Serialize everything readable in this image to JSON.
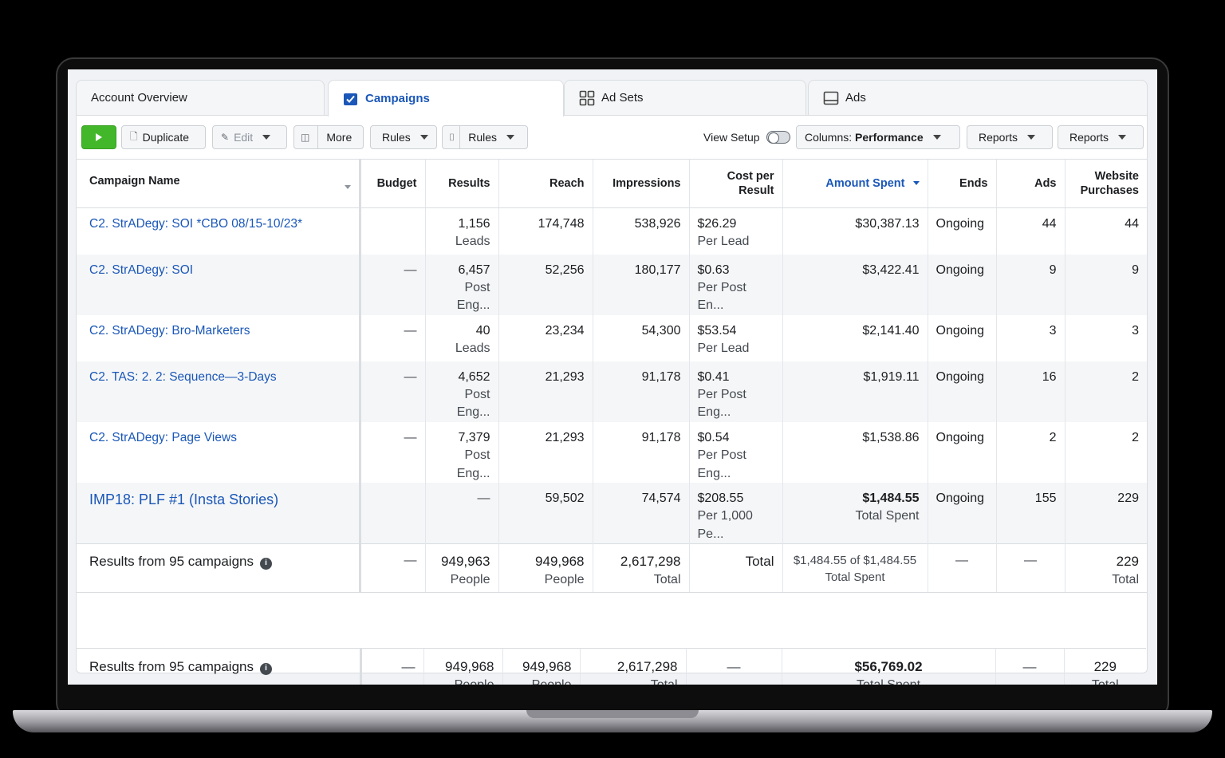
{
  "tabs": [
    {
      "label": "Account Overview",
      "icon": "none",
      "active": false
    },
    {
      "label": "Campaigns",
      "icon": "checkbox-icon",
      "active": true
    },
    {
      "label": "Ad Sets",
      "icon": "grid-icon",
      "active": false
    },
    {
      "label": "Ads",
      "icon": "ad-icon",
      "active": false
    }
  ],
  "toolbar": {
    "duplicate": "Duplicate",
    "edit": "Edit",
    "more": "More",
    "rules1": "Rules",
    "rules2": "Rules",
    "view_setup": "View Setup",
    "columns_prefix": "Columns: ",
    "columns_value": "Performance",
    "reports1": "Reports",
    "reports2": "Reports"
  },
  "columns": [
    "Campaign Name",
    "Budget",
    "Results",
    "Reach",
    "Impressions",
    "Cost per Result",
    "Amount Spent",
    "Ends",
    "Ads",
    "Website Purchases"
  ],
  "rows": [
    {
      "name": "C2. StrADegy: SOI *CBO 08/15-10/23*",
      "budget": "",
      "results": "1,156",
      "results_sub": "Leads",
      "reach": "174,748",
      "impressions": "538,926",
      "cpr": "$26.29",
      "cpr_sub": "Per Lead",
      "spent": "$30,387.13",
      "spent_sub": "",
      "ends": "Ongoing",
      "ads": "44",
      "purchases": "44"
    },
    {
      "name": "C2. StrADegy: SOI",
      "budget": "—",
      "results": "6,457",
      "results_sub": "Post Eng...",
      "reach": "52,256",
      "impressions": "180,177",
      "cpr": "$0.63",
      "cpr_sub": "Per Post En...",
      "spent": "$3,422.41",
      "spent_sub": "",
      "ends": "Ongoing",
      "ads": "9",
      "purchases": "9"
    },
    {
      "name": "C2. StrADegy: Bro-Marketers",
      "budget": "—",
      "results": "40",
      "results_sub": "Leads",
      "reach": "23,234",
      "impressions": "54,300",
      "cpr": "$53.54",
      "cpr_sub": "Per Lead",
      "spent": "$2,141.40",
      "spent_sub": "",
      "ends": "Ongoing",
      "ads": "3",
      "purchases": "3"
    },
    {
      "name": "C2. TAS: 2. 2: Sequence—3-Days",
      "budget": "—",
      "results": "4,652",
      "results_sub": "Post Eng...",
      "reach": "21,293",
      "impressions": "91,178",
      "cpr": "$0.41",
      "cpr_sub": "Per Post Eng...",
      "spent": "$1,919.11",
      "spent_sub": "",
      "ends": "Ongoing",
      "ads": "16",
      "purchases": "2"
    },
    {
      "name": "C2. StrADegy: Page Views",
      "budget": "—",
      "results": "7,379",
      "results_sub": "Post Eng...",
      "reach": "21,293",
      "impressions": "91,178",
      "cpr": "$0.54",
      "cpr_sub": "Per Post Eng...",
      "spent": "$1,538.86",
      "spent_sub": "",
      "ends": "Ongoing",
      "ads": "2",
      "purchases": "2"
    },
    {
      "name": "IMP18: PLF #1 (Insta Stories)",
      "budget": "",
      "results": "—",
      "results_sub": "",
      "reach": "59,502",
      "impressions": "74,574",
      "cpr": "$208.55",
      "cpr_sub": "Per 1,000 Pe...",
      "spent": "$1,484.55",
      "spent_sub": "Total Spent",
      "ends": "Ongoing",
      "ads": "155",
      "purchases": "229"
    }
  ],
  "summary": {
    "label": "Results from 95 campaigns",
    "budget": "—",
    "results": "949,963",
    "results_sub": "People",
    "reach": "949,968",
    "reach_sub": "People",
    "impressions": "2,617,298",
    "impressions_sub": "Total",
    "cpr": "Total",
    "spent": "$1,484.55 of $1,484.55",
    "spent_sub": "Total Spent",
    "ends": "—",
    "ads": "—",
    "purchases": "229",
    "purchases_sub": "Total"
  },
  "footer": {
    "label": "Results from 95 campaigns",
    "budget": "—",
    "results": "949,968",
    "results_sub": "People",
    "reach": "949,968",
    "reach_sub": "People",
    "impressions": "2,617,298",
    "impressions_sub": "Total",
    "cpr": "—",
    "spent": "$56,769.02",
    "spent_sub": "Total Spent",
    "ads": "—",
    "purchases": "229",
    "purchases_sub": "Total"
  },
  "colors": {
    "accent": "#1a57b8",
    "green": "#42b72a"
  }
}
